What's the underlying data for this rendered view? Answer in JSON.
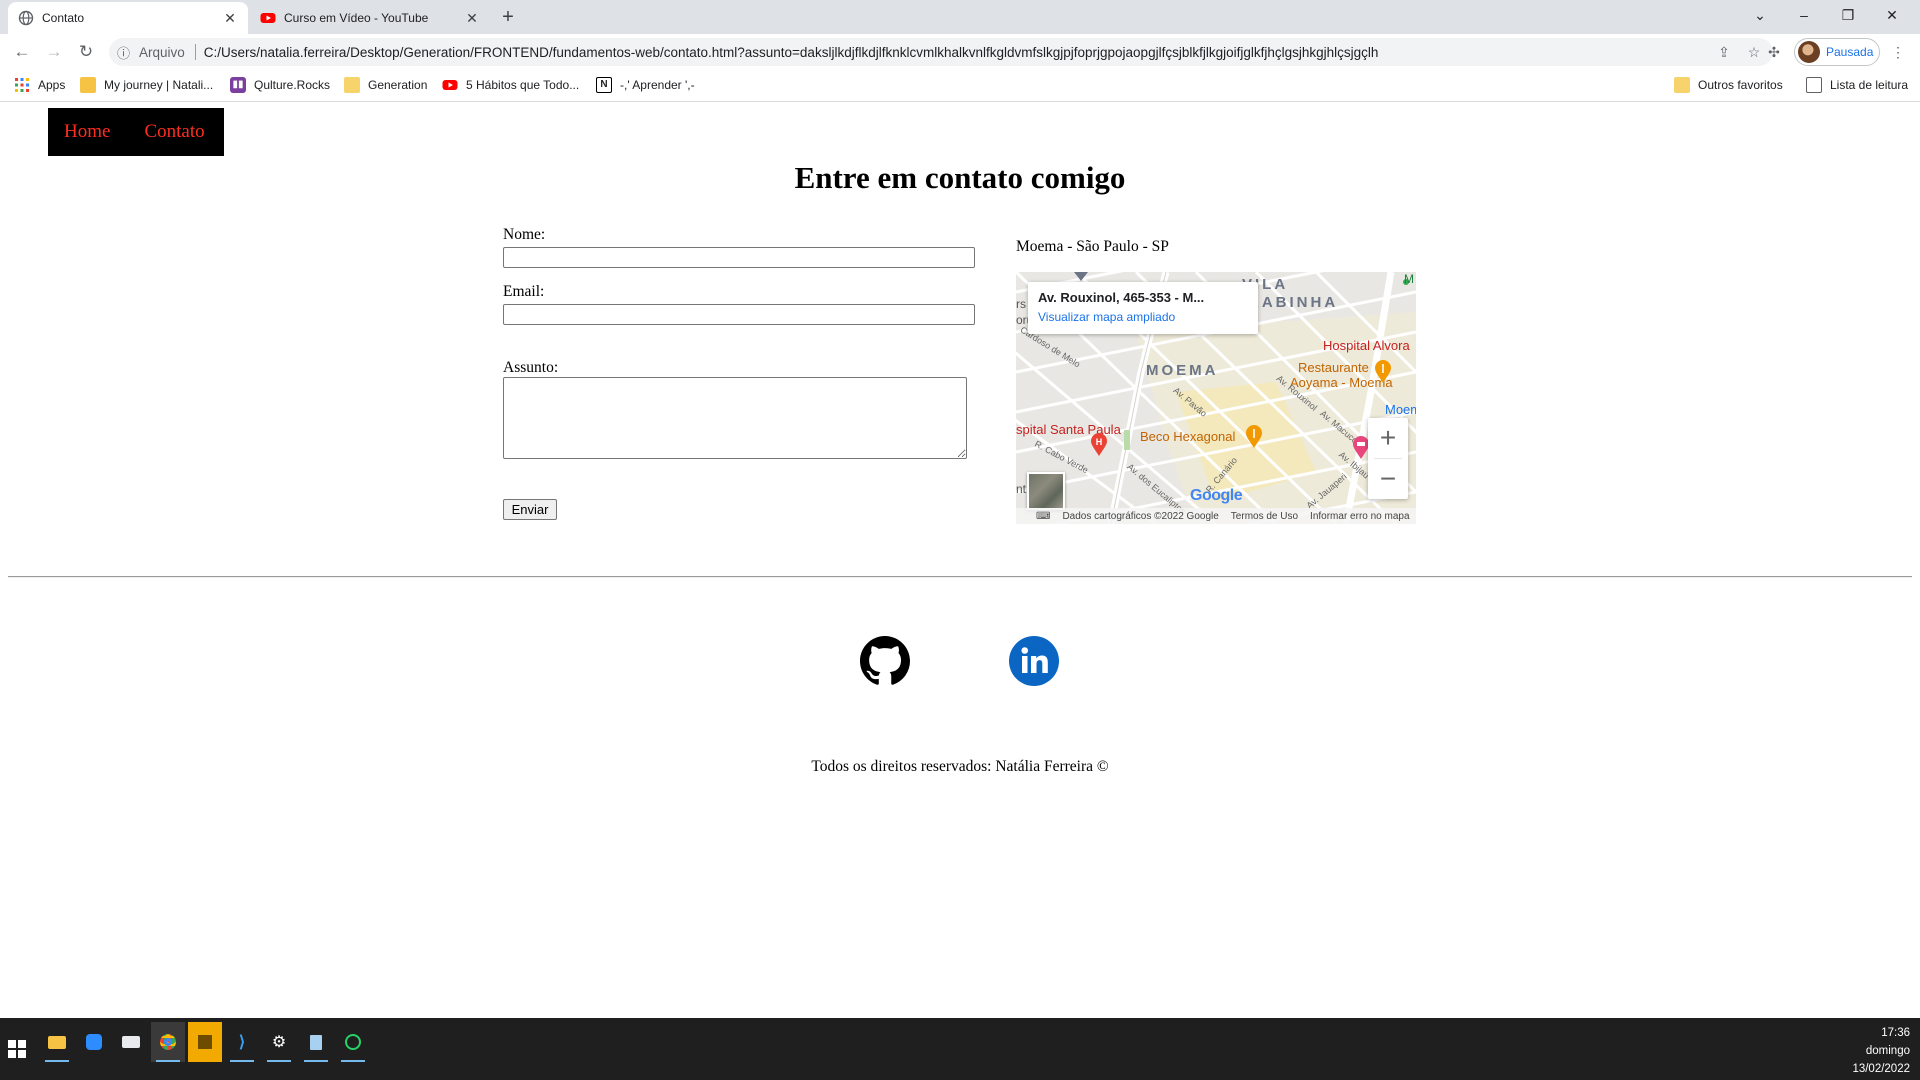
{
  "browser": {
    "tabs": [
      {
        "title": "Contato",
        "active": true
      },
      {
        "title": "Curso em Vídeo - YouTube",
        "active": false
      }
    ],
    "address_prefix": "Arquivo",
    "url": "C:/Users/natalia.ferreira/Desktop/Generation/FRONTEND/fundamentos-web/contato.html?assunto=daksljlkdjflkdjlfknklcvmlkhalkvnlfkgldvmfslkgjpjfoprjgpojaopgjlfçsjblkfjlkgjoifjglkfjhçlgsjhkgjhlçsjgçlh",
    "profile_label": "Pausada",
    "bookmarks": [
      {
        "label": "Apps",
        "icon": "apps-grid-icon"
      },
      {
        "label": "My journey | Natali...",
        "icon": "journey-icon"
      },
      {
        "label": "Qulture.Rocks",
        "icon": "qulture-icon"
      },
      {
        "label": "Generation",
        "icon": "folder-icon"
      },
      {
        "label": "5 Hábitos que Todo...",
        "icon": "youtube-icon"
      },
      {
        "label": "-,' Aprender ',-",
        "icon": "notion-icon"
      }
    ],
    "bookmarks_right": [
      {
        "label": "Outros favoritos",
        "icon": "folder-icon"
      },
      {
        "label": "Lista de leitura",
        "icon": "reading-list-icon"
      }
    ]
  },
  "site": {
    "nav": {
      "home": "Home",
      "contato": "Contato"
    },
    "title": "Entre em contato comigo",
    "form": {
      "name_label": "Nome:",
      "email_label": "Email:",
      "subject_label": "Assunto:",
      "name_value": "",
      "email_value": "",
      "subject_value": "",
      "submit_label": "Enviar"
    },
    "map": {
      "caption": "Moema - São Paulo - SP",
      "card_address": "Av. Rouxinol, 465-353 - M...",
      "card_link": "Visualizar mapa ampliado",
      "places": {
        "vila": "VILA",
        "arabinha": "RABINHA",
        "moema": "MOEMA",
        "hospital_alvorada": "Hospital Alvora",
        "restaurante": "Restaurante",
        "aoyama": "Aoyama - Moema",
        "moema_station": "Moema",
        "santa_paula": "spital Santa Paula",
        "beco": "Beco Hexagonal",
        "st_cardoso": "Cardoso de Melo",
        "st_pavao": "Av. Pavão",
        "st_macuco": "Av. Macuco",
        "st_ibijau": "Av. Ibijaú",
        "st_canario": "R. Canário",
        "st_cabo_verde": "R. Cabo Verde",
        "st_jauaperi": "Av. Jauaperi",
        "st_eucaliptos": "Av. dos Eucaliptos",
        "st_rouxinol": "Av. Rouxinol",
        "edge_rs": "rs",
        "edge_ru": "oru",
        "edge_nt": "nt",
        "edge_m": "M"
      },
      "google": "Google",
      "footer": {
        "data": "Dados cartográficos ©2022 Google",
        "terms": "Termos de Uso",
        "report": "Informar erro no mapa"
      }
    },
    "social": [
      "github-icon",
      "linkedin-icon"
    ],
    "footer_text": "Todos os direitos reservados: Natália Ferreira ©"
  },
  "taskbar": {
    "apps": [
      "file-explorer-icon",
      "zoom-icon",
      "mail-icon",
      "chrome-icon",
      "sticky-notes-icon",
      "vscode-icon",
      "settings-icon",
      "notepad-icon",
      "whatsapp-icon"
    ],
    "time": "17:36",
    "day": "domingo",
    "date": "13/02/2022"
  },
  "colors": {
    "nav_background": "#000000",
    "nav_link": "#ff2d20",
    "linkedin": "#0a66c2",
    "accent_blue": "#1a73e8"
  }
}
